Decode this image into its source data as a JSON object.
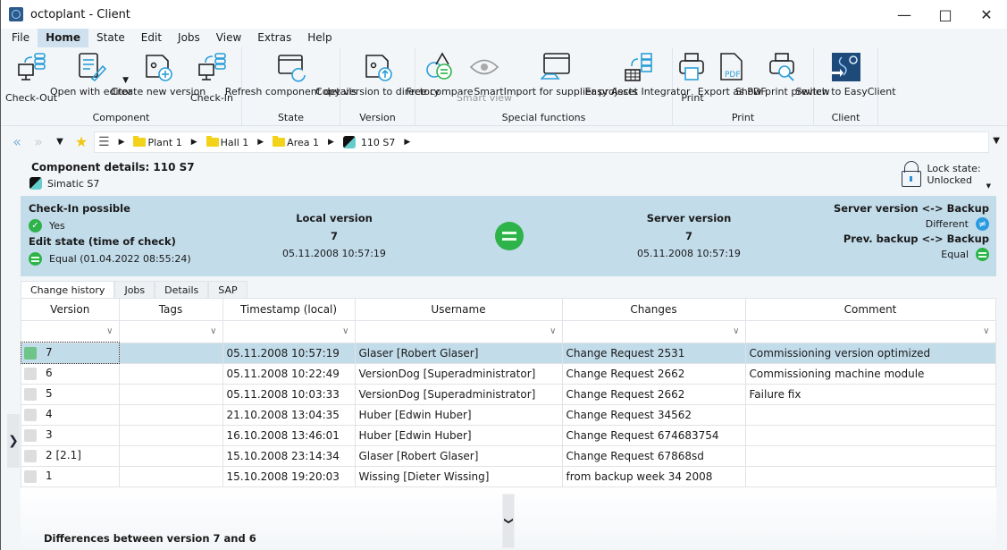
{
  "window": {
    "title": "octoplant - Client",
    "controls": [
      "minimize",
      "maximize",
      "close"
    ]
  },
  "menu": [
    "File",
    "Home",
    "State",
    "Edit",
    "Jobs",
    "View",
    "Extras",
    "Help"
  ],
  "menu_active": "Home",
  "ribbon": {
    "groups": [
      {
        "label": "Component",
        "buttons": [
          {
            "label": "Check-Out",
            "icon": "check-out-icon"
          },
          {
            "label": "Open with editor",
            "icon": "editor-icon",
            "dropdown": true
          },
          {
            "label": "Create new version",
            "icon": "new-version-icon"
          },
          {
            "label": "Check-In",
            "icon": "check-in-icon"
          }
        ]
      },
      {
        "label": "State",
        "buttons": [
          {
            "label": "Refresh component details",
            "icon": "refresh-icon"
          }
        ]
      },
      {
        "label": "Version",
        "buttons": [
          {
            "label": "Copy version to directory",
            "icon": "copy-version-icon"
          }
        ]
      },
      {
        "label": "Special functions",
        "buttons": [
          {
            "label": "Free compare",
            "icon": "compare-icon"
          },
          {
            "label": "Smart view",
            "icon": "eye-icon",
            "disabled": true
          },
          {
            "label": "SmartImport for supplier projects",
            "icon": "smartimport-icon"
          },
          {
            "label": "Easy Asset Integrator",
            "icon": "asset-icon"
          }
        ]
      },
      {
        "label": "Print",
        "buttons": [
          {
            "label": "Print",
            "icon": "printer-icon"
          },
          {
            "label": "Export as PDF",
            "icon": "pdf-icon"
          },
          {
            "label": "Show print preview",
            "icon": "print-preview-icon"
          }
        ]
      },
      {
        "label": "Client",
        "buttons": [
          {
            "label": "Switch to EasyClient",
            "icon": "easyclient-icon"
          }
        ]
      }
    ]
  },
  "breadcrumb": [
    "Plant 1",
    "Hall 1",
    "Area 1",
    "110 S7"
  ],
  "component": {
    "title": "Component details: 110 S7",
    "type": "Simatic S7",
    "lock_label": "Lock state:",
    "lock_value": "Unlocked"
  },
  "status": {
    "checkin_label": "Check-In possible",
    "checkin_value": "Yes",
    "edit_label": "Edit state (time of check)",
    "edit_value": "Equal (01.04.2022 08:55:24)",
    "local_label": "Local version",
    "local_version": "7",
    "local_time": "05.11.2008 10:57:19",
    "server_label": "Server version",
    "server_version": "7",
    "server_time": "05.11.2008 10:57:19",
    "srv_backup_label": "Server version <-> Backup",
    "srv_backup_value": "Different",
    "prev_backup_label": "Prev. backup <-> Backup",
    "prev_backup_value": "Equal"
  },
  "tabs": [
    "Change history",
    "Jobs",
    "Details",
    "SAP"
  ],
  "table": {
    "columns": [
      "Version",
      "Tags",
      "Timestamp (local)",
      "Username",
      "Changes",
      "Comment"
    ],
    "rows": [
      [
        "7",
        "",
        "05.11.2008 10:57:19",
        "Glaser [Robert Glaser]",
        "Change Request 2531",
        "Commissioning version optimized"
      ],
      [
        "6",
        "",
        "05.11.2008 10:22:49",
        "VersionDog [Superadministrator]",
        "Change Request 2662",
        "Commissioning machine module"
      ],
      [
        "5",
        "",
        "05.11.2008 10:03:33",
        "VersionDog [Superadministrator]",
        "Change Request 2662",
        "Failure fix"
      ],
      [
        "4",
        "",
        "21.10.2008 13:04:35",
        "Huber [Edwin Huber]",
        "Change Request 34562",
        ""
      ],
      [
        "3",
        "",
        "16.10.2008 13:46:01",
        "Huber [Edwin Huber]",
        "Change Request 674683754",
        ""
      ],
      [
        "2 [2.1]",
        "",
        "15.10.2008 23:14:34",
        "Glaser [Robert Glaser]",
        "Change Request 67868sd",
        ""
      ],
      [
        "1",
        "",
        "15.10.2008 19:20:03",
        "Wissing [Dieter Wissing]",
        "from backup week 34 2008",
        ""
      ]
    ],
    "selected_row": 0
  },
  "differences_title": "Differences between version 7 and 6"
}
